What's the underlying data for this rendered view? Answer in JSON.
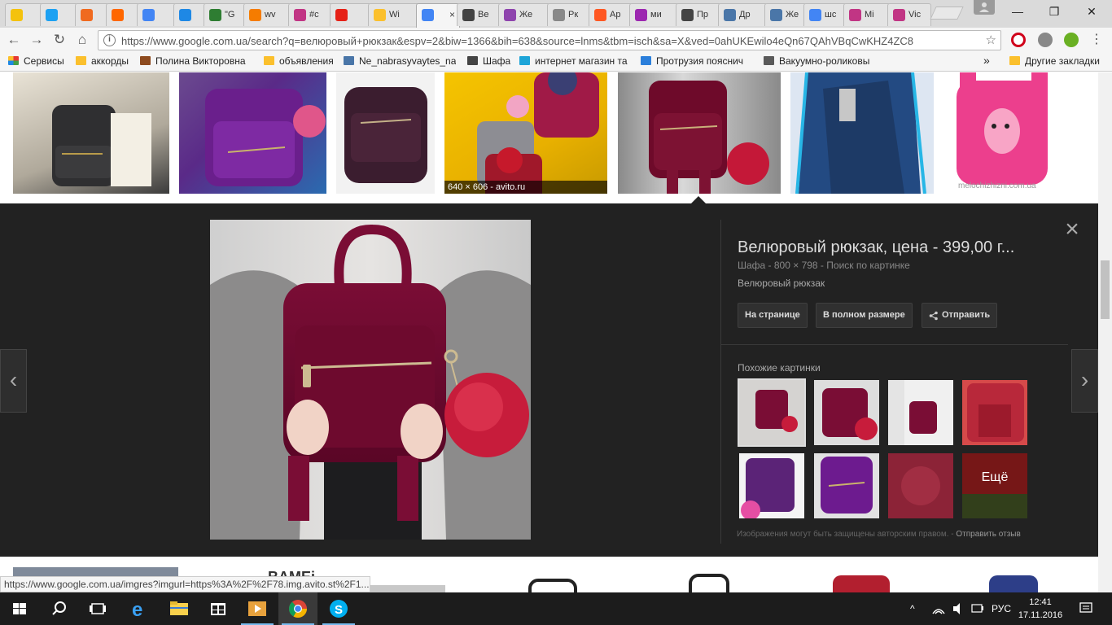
{
  "browser": {
    "tabs": [
      {
        "title": "",
        "icon": "sun-icon",
        "color": "#f4c20d"
      },
      {
        "title": "",
        "icon": "twitter-icon",
        "color": "#1da1f2"
      },
      {
        "title": "",
        "icon": "orange-square-icon",
        "color": "#f06a1f"
      },
      {
        "title": "",
        "icon": "mi-icon",
        "color": "#ff6700"
      },
      {
        "title": "",
        "icon": "google-icon",
        "color": "#4285f4"
      },
      {
        "title": "",
        "icon": "24-icon",
        "color": "#1e88e5"
      },
      {
        "title": "\"G",
        "icon": "globe-icon",
        "color": "#2e7d32"
      },
      {
        "title": "wv",
        "icon": "orange-app-icon",
        "color": "#f57c00"
      },
      {
        "title": "#c",
        "icon": "instagram-icon",
        "color": "#c13584"
      },
      {
        "title": "",
        "icon": "youtube-icon",
        "color": "#e62117"
      },
      {
        "title": "Wi",
        "icon": "emoji-icon",
        "color": "#fbc02d"
      },
      {
        "title": "",
        "icon": "google-icon",
        "color": "#4285f4",
        "active": true
      },
      {
        "title": "Ве",
        "icon": "shafa-icon",
        "color": "#444444"
      },
      {
        "title": "Же",
        "icon": "g-purple-icon",
        "color": "#8e44ad"
      },
      {
        "title": "Рк",
        "icon": "cart-icon",
        "color": "#888888"
      },
      {
        "title": "Ар",
        "icon": "olx-icon",
        "color": "#ff5722"
      },
      {
        "title": "ми",
        "icon": "c-icon",
        "color": "#9c27b0"
      },
      {
        "title": "Пр",
        "icon": "shafa-icon",
        "color": "#444444"
      },
      {
        "title": "Др",
        "icon": "vk-icon",
        "color": "#4a76a8"
      },
      {
        "title": "Же",
        "icon": "vk-icon",
        "color": "#4a76a8"
      },
      {
        "title": "шс",
        "icon": "google-icon",
        "color": "#4285f4"
      },
      {
        "title": "Мi",
        "icon": "instagram-icon",
        "color": "#c13584"
      },
      {
        "title": "Vic",
        "icon": "instagram-icon",
        "color": "#c13584"
      }
    ],
    "url": "https://www.google.com.ua/search?q=велюровый+рюкзак&espv=2&biw=1366&bih=638&source=lnms&tbm=isch&sa=X&ved=0ahUKEwilo4eQn67QAhVBqCwKHZ4ZC8",
    "bookmarks": [
      {
        "label": "Сервисы",
        "color": "#e53935"
      },
      {
        "label": "аккорды",
        "color": "#fbc02d"
      },
      {
        "label": "Полина Викторовна",
        "color": "#8d4a1e"
      },
      {
        "label": "объявления",
        "color": "#fbc02d"
      },
      {
        "label": "Ne_nabrasyvaytes_na_",
        "color": "#4a76a8"
      },
      {
        "label": "Шафа",
        "color": "#444444"
      },
      {
        "label": "интернет магазин та",
        "color": "#1ea5d8"
      },
      {
        "label": "Протрузия пояснич",
        "color": "#2b7fdb"
      },
      {
        "label": "Вакуумно-роликовы",
        "color": "#5a5a5a"
      },
      {
        "label": "Другие закладки",
        "color": "#fbc02d"
      }
    ],
    "more_bookmarks": "»",
    "status_url": "https://www.google.com.ua/imgres?imgurl=https%3A%2F%2F78.img.avito.st%2F1..."
  },
  "results": {
    "top_row_label": "640 × 606 - avito.ru",
    "bottom_row_text": "BAMEi"
  },
  "detail": {
    "title": "Велюровый рюкзак, цена - 399,00 г...",
    "meta": "Шафа - 800 × 798 - Поиск по картинке",
    "description": "Велюровый рюкзак",
    "buttons": {
      "visit": "На странице",
      "full": "В полном размере",
      "share": "Отправить"
    },
    "similar_label": "Похожие картинки",
    "more_label": "Ещё",
    "copyright": "Изображения могут быть защищены авторским правом.",
    "separator": "-",
    "feedback": "Отправить отзыв"
  },
  "taskbar": {
    "lang": "РУС",
    "time": "12:41",
    "date": "17.11.2016"
  }
}
